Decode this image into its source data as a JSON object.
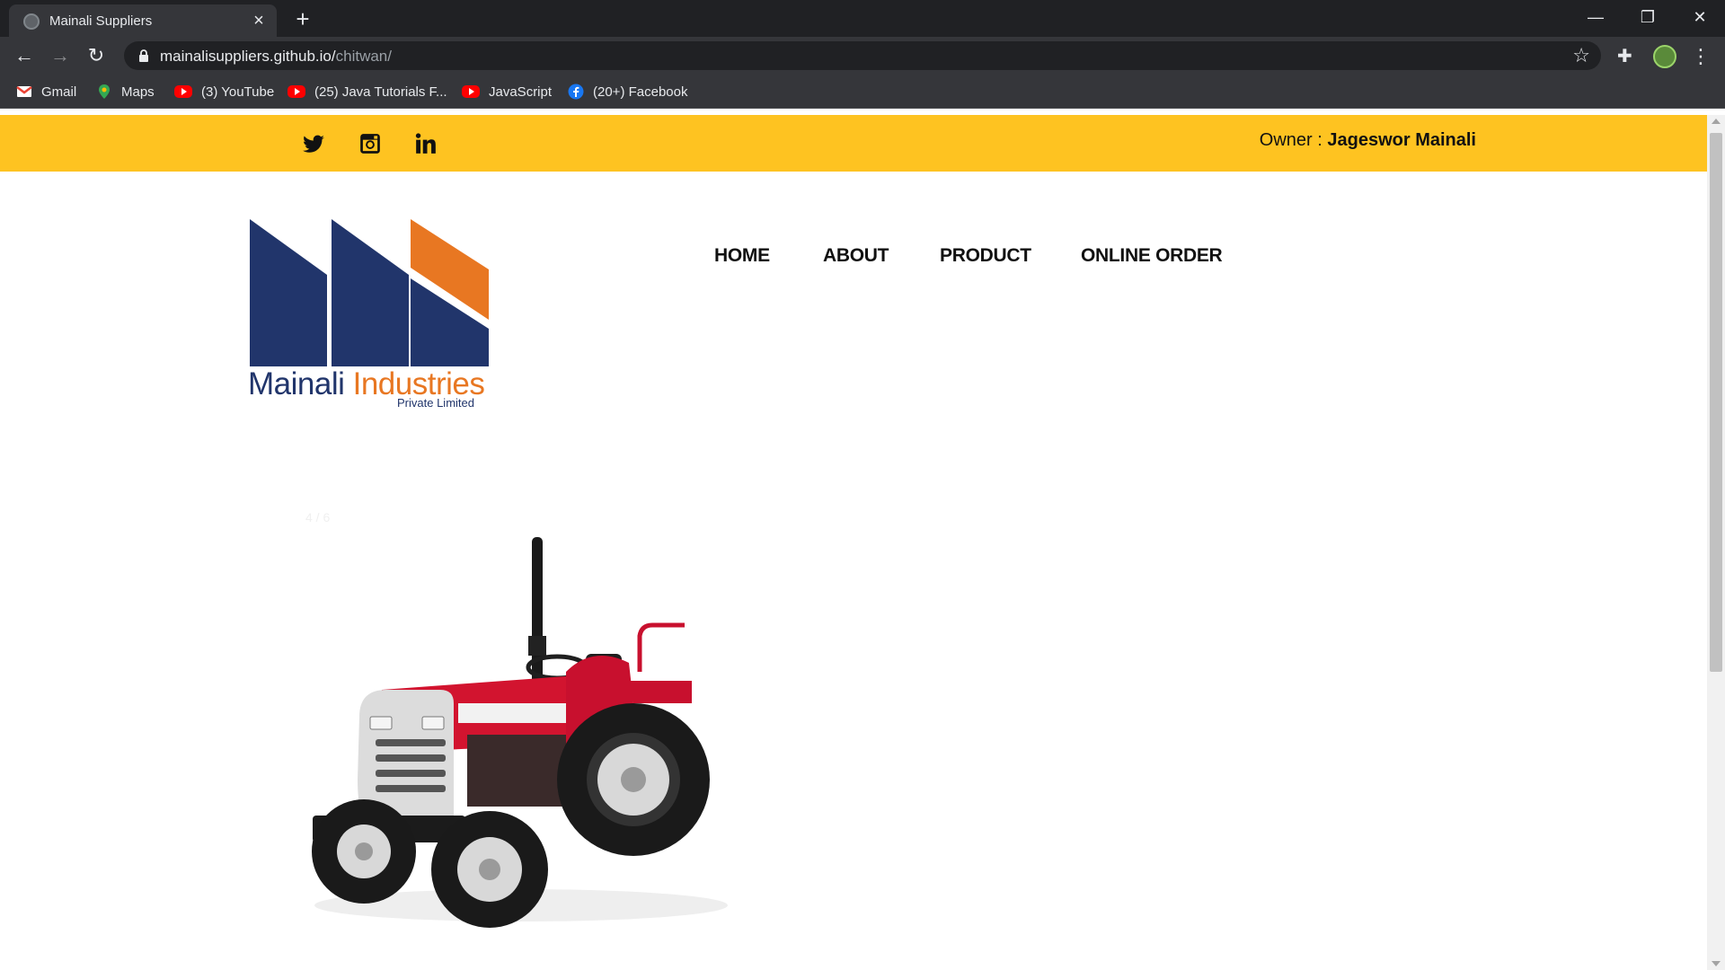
{
  "browser": {
    "tab_title": "Mainali Suppliers",
    "url_host": "mainalisuppliers.github.io/",
    "url_path": "chitwan/",
    "bookmarks": [
      {
        "label": "Gmail",
        "icon": "gmail-icon"
      },
      {
        "label": "Maps",
        "icon": "maps-icon"
      },
      {
        "label": "(3) YouTube",
        "icon": "youtube-icon"
      },
      {
        "label": "(25) Java Tutorials F...",
        "icon": "youtube-icon"
      },
      {
        "label": "JavaScript",
        "icon": "youtube-icon"
      },
      {
        "label": "(20+) Facebook",
        "icon": "facebook-icon"
      }
    ]
  },
  "topbar": {
    "owner_label": "Owner : ",
    "owner_name": "Jageswor Mainali",
    "social": [
      "twitter-icon",
      "instagram-icon",
      "linkedin-icon"
    ]
  },
  "logo": {
    "name_part1": "Mainali ",
    "name_part2": "Industries",
    "subtitle": "Private Limited"
  },
  "nav": {
    "items": [
      "HOME",
      "ABOUT",
      "PRODUCT",
      "ONLINE ORDER"
    ]
  },
  "slider": {
    "counter": "4 / 6",
    "image": "tractor-image"
  },
  "colors": {
    "topbar": "#fec321",
    "logo_blue": "#21356b",
    "logo_orange": "#e87722",
    "tractor_red": "#c8102e"
  }
}
